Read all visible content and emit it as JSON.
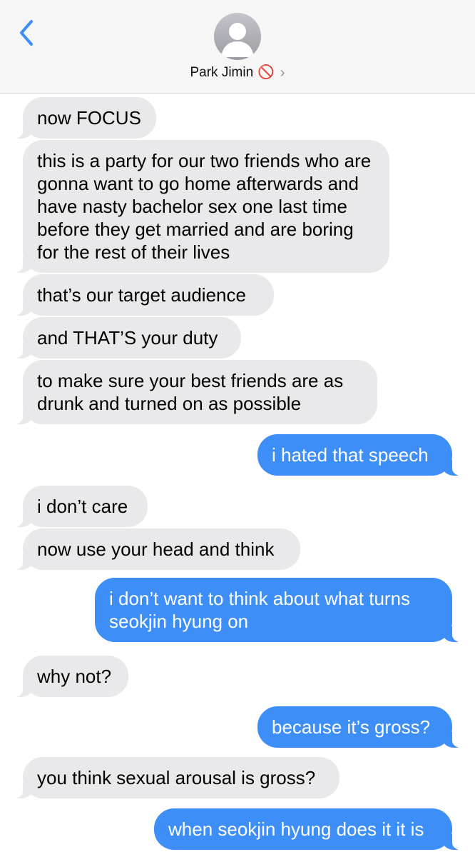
{
  "header": {
    "contact_name": "Park Jimin",
    "status_emoji": "🚫",
    "chevron": "›",
    "accent_color": "#3d8ef7"
  },
  "messages": [
    {
      "from": "them",
      "text": "now FOCUS"
    },
    {
      "from": "them",
      "text": "this is a party for our two friends who are gonna want to go home afterwards and have nasty bachelor sex one last time before they get married and are boring for the rest of their lives"
    },
    {
      "from": "them",
      "text": "that’s our target audience"
    },
    {
      "from": "them",
      "text": "and THAT’S your duty"
    },
    {
      "from": "them",
      "text": "to make sure your best friends are as drunk and turned on as possible"
    },
    {
      "from": "me",
      "text": "i hated that speech"
    },
    {
      "from": "them",
      "text": "i don’t care"
    },
    {
      "from": "them",
      "text": "now use your head and think"
    },
    {
      "from": "me",
      "text": "i don’t want to think about what turns seokjin hyung on"
    },
    {
      "from": "them",
      "text": "why not?"
    },
    {
      "from": "me",
      "text": "because it’s gross?"
    },
    {
      "from": "them",
      "text": "you think sexual arousal is gross?"
    },
    {
      "from": "me",
      "text": "when seokjin hyung does it it is"
    }
  ]
}
